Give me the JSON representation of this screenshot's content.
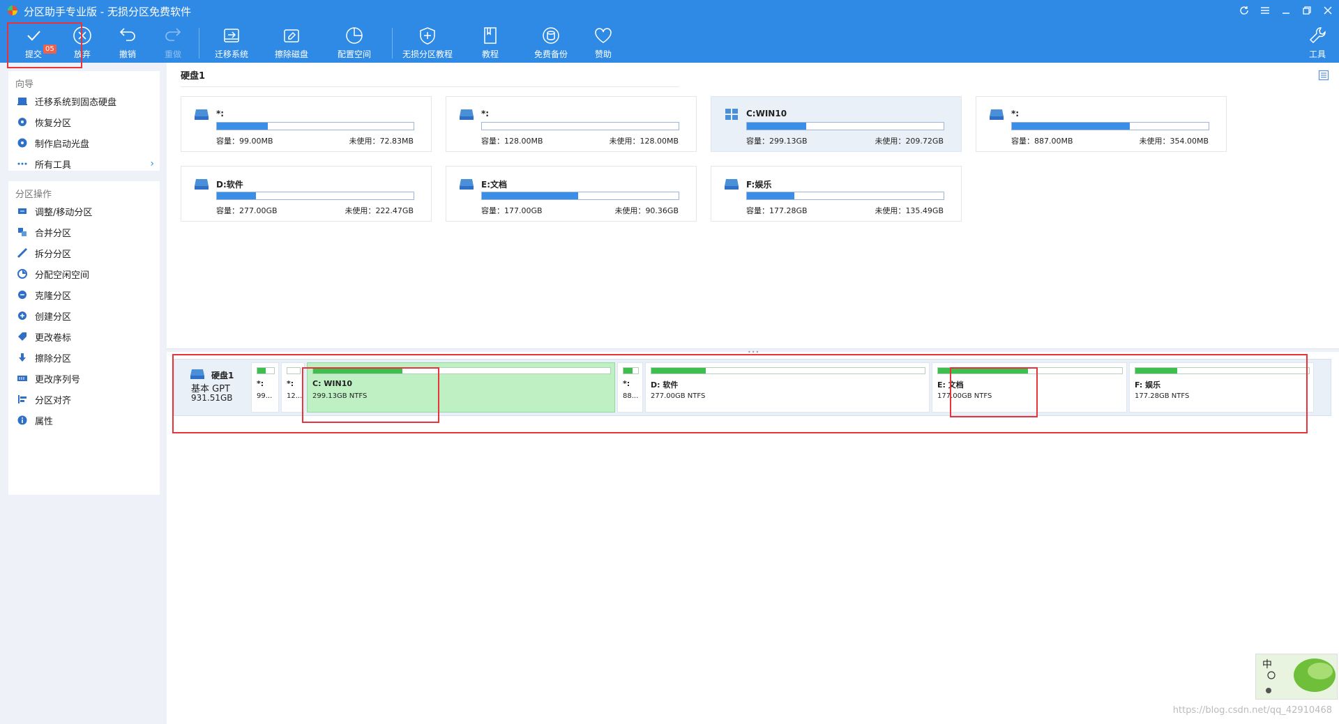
{
  "window": {
    "title": "分区助手专业版 - 无损分区免费软件",
    "controls": [
      "refresh-icon",
      "menu-icon",
      "minimize-icon",
      "restore-icon",
      "close-icon"
    ]
  },
  "toolbar": {
    "commit_label": "提交",
    "commit_badge": "05",
    "discard_label": "放弃",
    "undo_label": "撤销",
    "redo_label": "重做",
    "migrate_label": "迁移系统",
    "wipe_disk_label": "擦除磁盘",
    "allocate_label": "配置空间",
    "tutorial_lossless_label": "无损分区教程",
    "tutorial_label": "教程",
    "backup_label": "免费备份",
    "donate_label": "赞助",
    "tools_label": "工具"
  },
  "sidebar": {
    "wizard_title": "向导",
    "wizard_items": [
      {
        "label": "迁移系统到固态硬盘",
        "icon": "migrate-ssd-icon"
      },
      {
        "label": "恢复分区",
        "icon": "recover-icon"
      },
      {
        "label": "制作启动光盘",
        "icon": "disc-icon"
      },
      {
        "label": "所有工具",
        "icon": "more-icon"
      }
    ],
    "ops_title": "分区操作",
    "ops_items": [
      {
        "label": "调整/移动分区",
        "icon": "resize-icon"
      },
      {
        "label": "合并分区",
        "icon": "merge-icon"
      },
      {
        "label": "拆分分区",
        "icon": "split-icon"
      },
      {
        "label": "分配空闲空间",
        "icon": "pie-icon"
      },
      {
        "label": "克隆分区",
        "icon": "clone-icon"
      },
      {
        "label": "创建分区",
        "icon": "create-icon"
      },
      {
        "label": "更改卷标",
        "icon": "tag-icon"
      },
      {
        "label": "擦除分区",
        "icon": "wipe-icon"
      },
      {
        "label": "更改序列号",
        "icon": "serial-icon"
      },
      {
        "label": "分区对齐",
        "icon": "align-icon"
      },
      {
        "label": "属性",
        "icon": "info-icon"
      }
    ]
  },
  "main": {
    "disk_title": "硬盘1",
    "cap_prefix": "容量：",
    "free_prefix": "未使用：",
    "cards": [
      {
        "name": "*:",
        "capacity": "99.00MB",
        "free": "72.83MB",
        "used": 0.26
      },
      {
        "name": "*:",
        "capacity": "128.00MB",
        "free": "128.00MB",
        "used": 0
      },
      {
        "name": "C:WIN10",
        "capacity": "299.13GB",
        "free": "209.72GB",
        "used": 0.3
      },
      {
        "name": "*:",
        "capacity": "887.00MB",
        "free": "354.00MB",
        "used": 0.6
      },
      {
        "name": "D:软件",
        "capacity": "277.00GB",
        "free": "222.47GB",
        "used": 0.2
      },
      {
        "name": "E:文档",
        "capacity": "177.00GB",
        "free": "90.36GB",
        "used": 0.49
      },
      {
        "name": "F:娱乐",
        "capacity": "177.28GB",
        "free": "135.49GB",
        "used": 0.24
      }
    ]
  },
  "diskmap": {
    "name": "硬盘1",
    "type": "基本 GPT",
    "size": "931.51GB",
    "segments": [
      {
        "label": "*:",
        "info": "99...",
        "used": 0.5
      },
      {
        "label": "*:",
        "info": "12...",
        "used": 0
      },
      {
        "label": "C: WIN10",
        "info": "299.13GB NTFS",
        "used": 0.3
      },
      {
        "label": "*:",
        "info": "88...",
        "used": 0.6
      },
      {
        "label": "D: 软件",
        "info": "277.00GB NTFS",
        "used": 0.2
      },
      {
        "label": "E: 文档",
        "info": "177.00GB NTFS",
        "used": 0.49
      },
      {
        "label": "F: 娱乐",
        "info": "177.28GB NTFS",
        "used": 0.24
      }
    ]
  },
  "ime": {
    "char": "中"
  },
  "watermark": "https://blog.csdn.net/qq_42910468"
}
